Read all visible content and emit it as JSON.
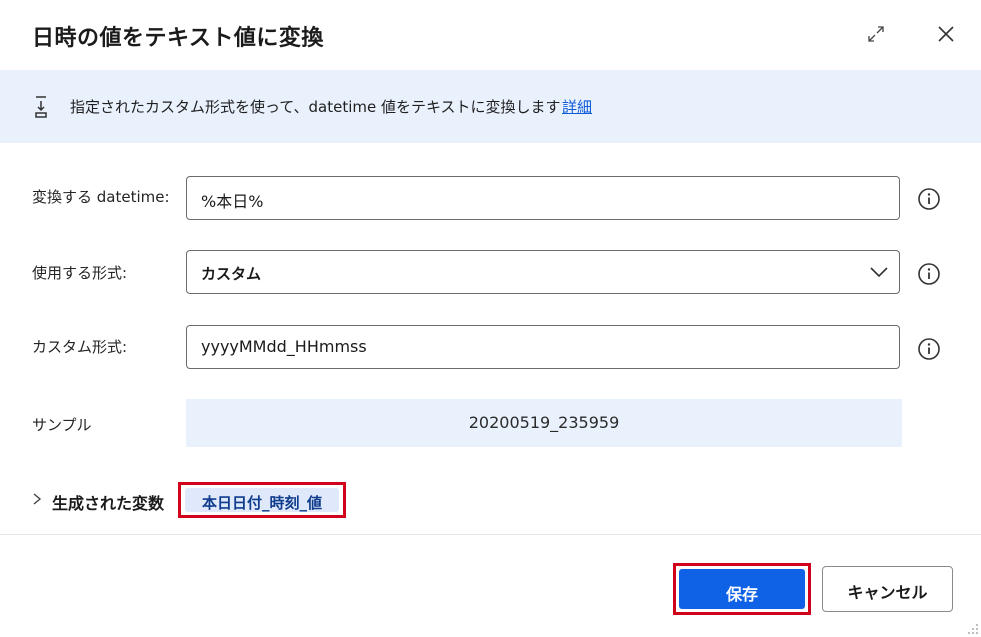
{
  "dialog": {
    "title": "日時の値をテキスト値に変換"
  },
  "banner": {
    "text": "指定されたカスタム形式を使って、datetime 値をテキストに変換します",
    "link": "詳細"
  },
  "fields": {
    "datetime": {
      "label": "変換する datetime:",
      "value": "%本日%"
    },
    "format": {
      "label": "使用する形式:",
      "value": "カスタム"
    },
    "custom_format": {
      "label": "カスタム形式:",
      "value": "yyyyMMdd_HHmmss"
    },
    "sample": {
      "label": "サンプル",
      "value": "20200519_235959"
    }
  },
  "generated": {
    "label": "生成された変数",
    "variable": "本日日付_時刻_値"
  },
  "buttons": {
    "save": "保存",
    "cancel": "キャンセル"
  },
  "colors": {
    "accent": "#0f62e6",
    "banner_bg": "#e9f1fd",
    "highlight_border": "#d0021b"
  }
}
